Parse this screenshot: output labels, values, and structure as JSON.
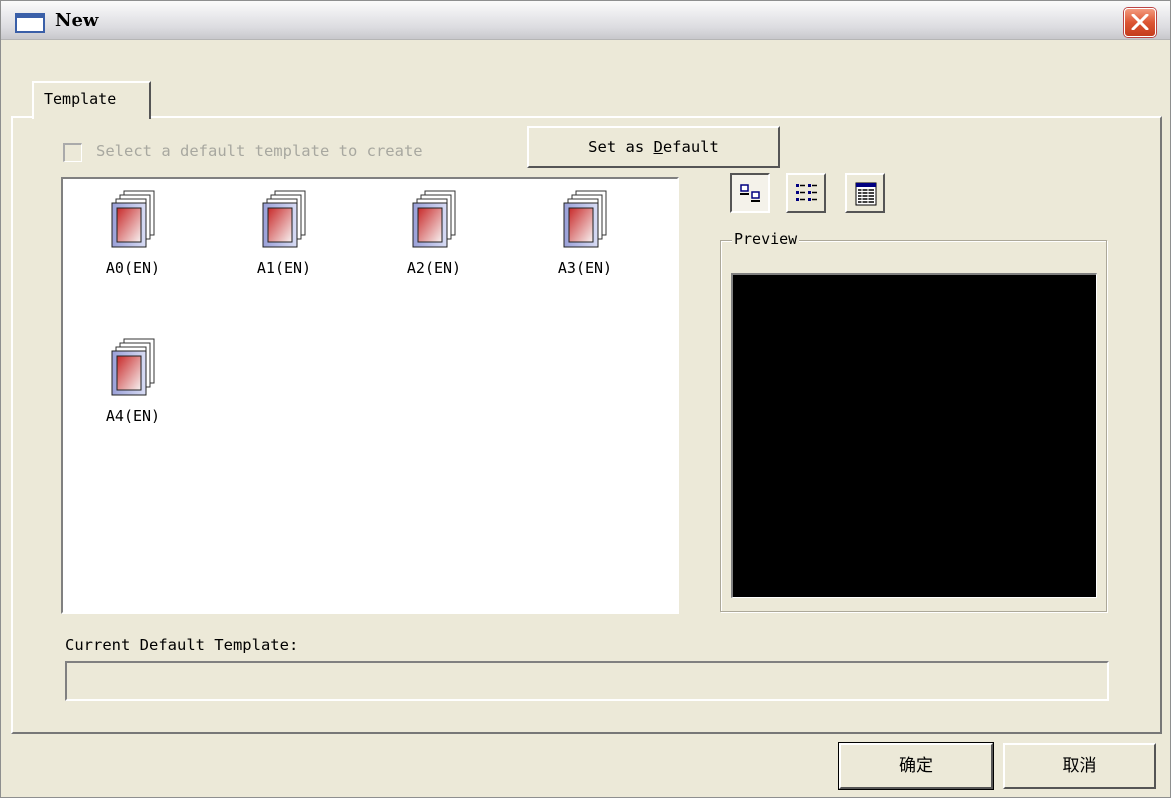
{
  "window": {
    "title": "New"
  },
  "tabs": [
    {
      "label": "Template"
    }
  ],
  "options": {
    "default_checkbox_label": "Select a default template to create",
    "default_checkbox_checked": false,
    "set_default_prefix": "Set as ",
    "set_default_mnemonic": "D",
    "set_default_suffix": "efault"
  },
  "templates": [
    {
      "label": "A0(EN)",
      "icon": "template-icon"
    },
    {
      "label": "A1(EN)",
      "icon": "template-icon"
    },
    {
      "label": "A2(EN)",
      "icon": "template-icon"
    },
    {
      "label": "A3(EN)",
      "icon": "template-icon"
    },
    {
      "label": "A4(EN)",
      "icon": "template-icon"
    }
  ],
  "view_modes": [
    {
      "name": "large-icons",
      "icon": "large-icons-view-icon",
      "active": true
    },
    {
      "name": "list",
      "icon": "list-view-icon",
      "active": false
    },
    {
      "name": "details",
      "icon": "details-view-icon",
      "active": false
    }
  ],
  "preview": {
    "label": "Preview"
  },
  "current_default": {
    "label": "Current Default Template:",
    "value": ""
  },
  "buttons": {
    "ok": "确定",
    "cancel": "取消"
  },
  "colors": {
    "close_button": "#dc5533",
    "preview_background": "#000000",
    "dialog_background": "#ece9d8"
  }
}
